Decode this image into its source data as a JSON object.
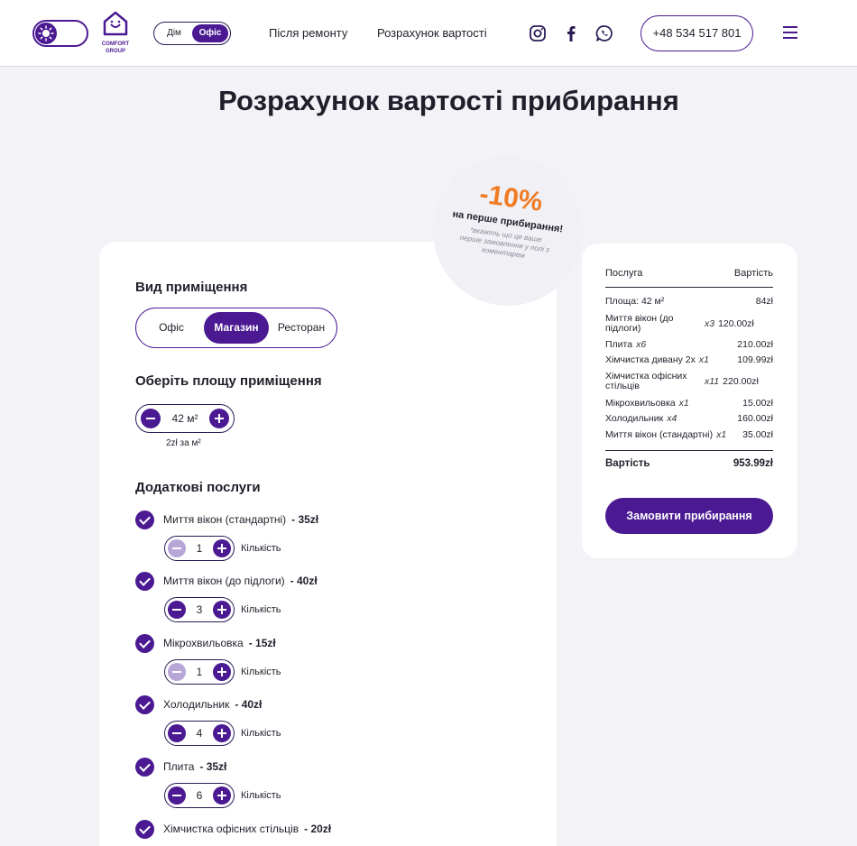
{
  "header": {
    "theme_toggle_icon": "sun-icon",
    "logo": {
      "icon": "house-logo-icon",
      "line1": "COMFORT",
      "line2": "GROUP"
    },
    "type_toggle": {
      "options": [
        "Дім",
        "Офіс"
      ],
      "selected": "Офіс"
    },
    "nav": [
      "Після ремонту",
      "Розрахунок вартості"
    ],
    "social_icons": [
      "instagram-icon",
      "facebook-icon",
      "whatsapp-icon"
    ],
    "phone": "+48 534 517 801",
    "menu_icon": "hamburger-icon"
  },
  "page_title": "Розрахунок вартості прибирання",
  "discount_badge": {
    "percent": "-10%",
    "text": "на перше прибирання!",
    "note": "*вкажіть що це ваше перше замовлення у полі з коментарем"
  },
  "calculator": {
    "room_type": {
      "title": "Вид приміщення",
      "options": [
        "Офіс",
        "Магазин",
        "Ресторан"
      ],
      "selected": "Магазин"
    },
    "area": {
      "title": "Оберіть площу приміщення",
      "value": "42 м²",
      "rate": "2zł за м²"
    },
    "extras": {
      "title": "Додаткові послуги",
      "qty_label": "Кількість",
      "items": [
        {
          "name": "Миття вікон (стандартні)",
          "price": "- 35zł",
          "qty": "1",
          "checked": true
        },
        {
          "name": "Миття вікон (до підлоги)",
          "price": "- 40zł",
          "qty": "3",
          "checked": true
        },
        {
          "name": "Мікрохвильовка",
          "price": "- 15zł",
          "qty": "1",
          "checked": true
        },
        {
          "name": "Холодильник",
          "price": "- 40zł",
          "qty": "4",
          "checked": true
        },
        {
          "name": "Плита",
          "price": "- 35zł",
          "qty": "6",
          "checked": true
        },
        {
          "name": "Хімчистка офісних стільців",
          "price": "- 20zł",
          "checked": true
        }
      ]
    }
  },
  "summary": {
    "col_service": "Послуга",
    "col_cost": "Вартість",
    "rows": [
      {
        "name": "Площа: 42 м²",
        "mult": "",
        "amount": "84zł"
      },
      {
        "name": "Миття вікон (до підлоги)",
        "mult": "x3",
        "amount": "120.00zł"
      },
      {
        "name": "Плита",
        "mult": "x6",
        "amount": "210.00zł"
      },
      {
        "name": "Хімчистка дивану 2х",
        "mult": "x1",
        "amount": "109.99zł"
      },
      {
        "name": "Хімчистка офісних стільців",
        "mult": "x11",
        "amount": "220.00zł"
      },
      {
        "name": "Мікрохвильовка",
        "mult": "x1",
        "amount": "15.00zł"
      },
      {
        "name": "Холодильник",
        "mult": "x4",
        "amount": "160.00zł"
      },
      {
        "name": "Миття вікон (стандартні)",
        "mult": "x1",
        "amount": "35.00zł"
      }
    ],
    "total_label": "Вартість",
    "total": "953.99zł",
    "order_button": "Замовити прибирання"
  }
}
